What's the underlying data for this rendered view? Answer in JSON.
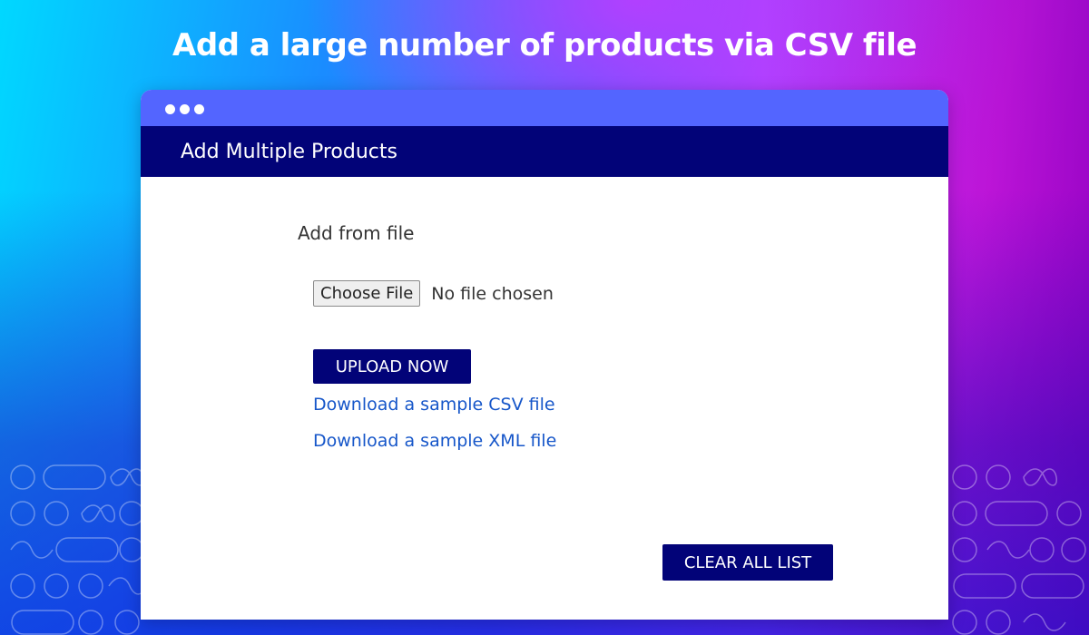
{
  "headline": "Add a large number of products via CSV file",
  "window": {
    "title": "Add Multiple Products"
  },
  "form": {
    "section_label": "Add from file",
    "choose_file_label": "Choose File",
    "file_status": "No file chosen",
    "upload_label": "UPLOAD NOW",
    "sample_csv_link": "Download a sample CSV file",
    "sample_xml_link": "Download a sample XML file",
    "clear_label": "CLEAR ALL LIST"
  },
  "colors": {
    "header_navy": "#020378",
    "titlebar_blue": "#5365ff",
    "link_blue": "#1656c9"
  }
}
